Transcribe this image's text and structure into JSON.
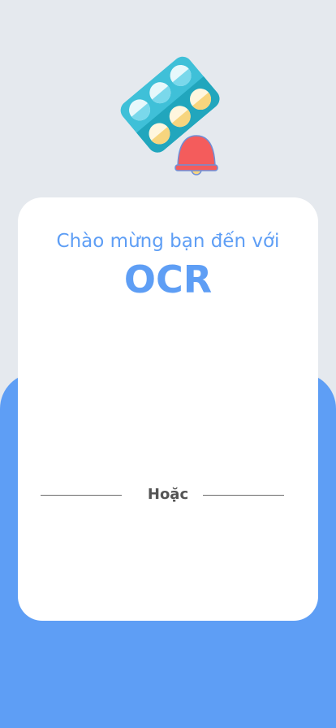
{
  "welcome": {
    "greeting": "Chào mừng bạn đến với",
    "app_name": "OCR"
  },
  "divider": {
    "label": "Hoặc"
  },
  "logo": {
    "icon": "pill-blister-bell-icon"
  }
}
